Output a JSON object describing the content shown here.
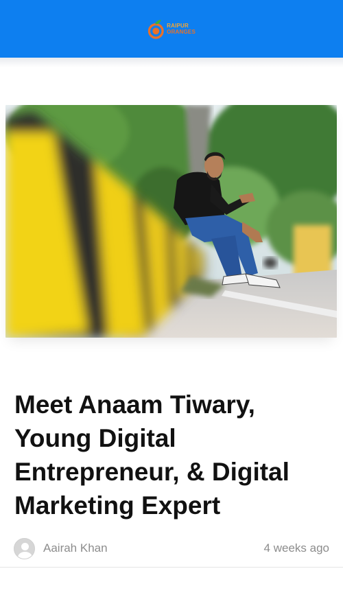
{
  "header": {
    "logo_line1": "RAIPUR",
    "logo_line2": "ORANGES",
    "background_color": "#0d7ff0"
  },
  "article": {
    "image_alt": "Man in black t-shirt and jeans sitting on a yellow and black road divider under trees",
    "title": "Meet Anaam Tiwary, Young Digital Entrepreneur, & Digital Marketing Expert",
    "author": "Aairah Khan",
    "published": "4 weeks ago"
  },
  "icons": {
    "logo": "orange-logo-icon",
    "avatar": "user-avatar-icon"
  }
}
